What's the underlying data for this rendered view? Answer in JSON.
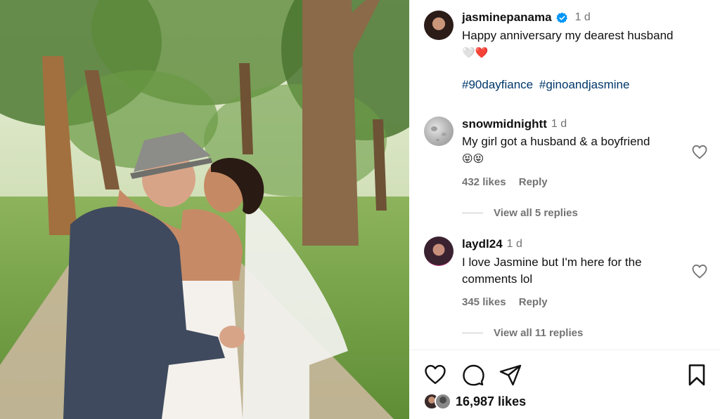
{
  "post": {
    "author": "jasminepanama",
    "time": "1 d",
    "caption": "Happy anniversary my dearest husband",
    "caption_emoji": "🤍❤️",
    "hashtags": [
      "#90dayfiance",
      "#ginoandjasmine"
    ],
    "likes": "16,987 likes"
  },
  "comments": [
    {
      "user": "snowmidnightt",
      "time": "1 d",
      "text": "My girl got a husband & a boyfriend",
      "emoji": "😝😝",
      "likes": "432 likes",
      "reply_label": "Reply",
      "view_replies": "View all 5 replies"
    },
    {
      "user": "laydl24",
      "time": "1 d",
      "text": "I love Jasmine but I'm here for the comments lol",
      "likes": "345 likes",
      "reply_label": "Reply",
      "view_replies": "View all 11 replies"
    }
  ],
  "icons": {
    "verified": "verified-badge-icon",
    "like": "heart-icon",
    "comment": "comment-bubble-icon",
    "share": "paper-plane-icon",
    "save": "bookmark-icon"
  },
  "colors": {
    "verified_blue": "#0095f6",
    "hashtag": "#00376b",
    "muted": "#737373"
  }
}
